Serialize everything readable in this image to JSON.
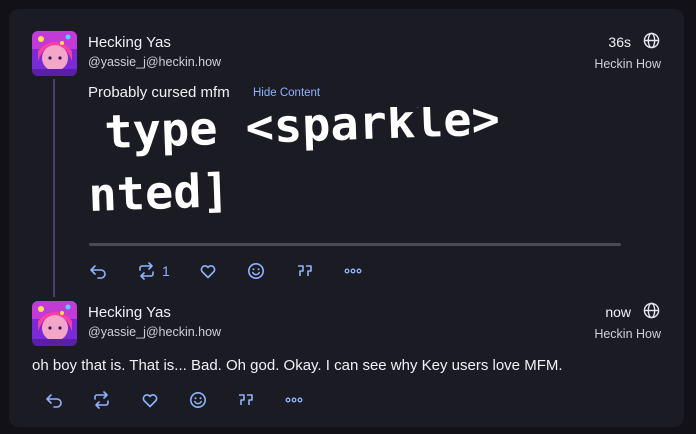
{
  "posts": [
    {
      "display_name": "Hecking Yas",
      "handle": "@yassie_j@heckin.how",
      "time": "36s",
      "instance": "Heckin How",
      "content_warning": "Probably cursed mfm",
      "hide_label": "Hide Content",
      "mfm_lines": [
        "e type <sparkle>",
        "mented]"
      ],
      "renote_count": "1"
    },
    {
      "display_name": "Hecking Yas",
      "handle": "@yassie_j@heckin.how",
      "time": "now",
      "instance": "Heckin How",
      "text": "oh boy that is. That is... Bad. Oh god. Okay. I can see why Key users love MFM."
    }
  ],
  "icons": {
    "reply": "reply-icon",
    "renote": "renote-icon",
    "like": "heart-icon",
    "react": "smiley-icon",
    "quote": "quote-icon",
    "more": "more-icon",
    "visibility": "globe-icon"
  },
  "colors": {
    "accent": "#8fb3ff",
    "background": "#111117",
    "card": "#1b1b24",
    "thread_line": "#4a3f70"
  }
}
